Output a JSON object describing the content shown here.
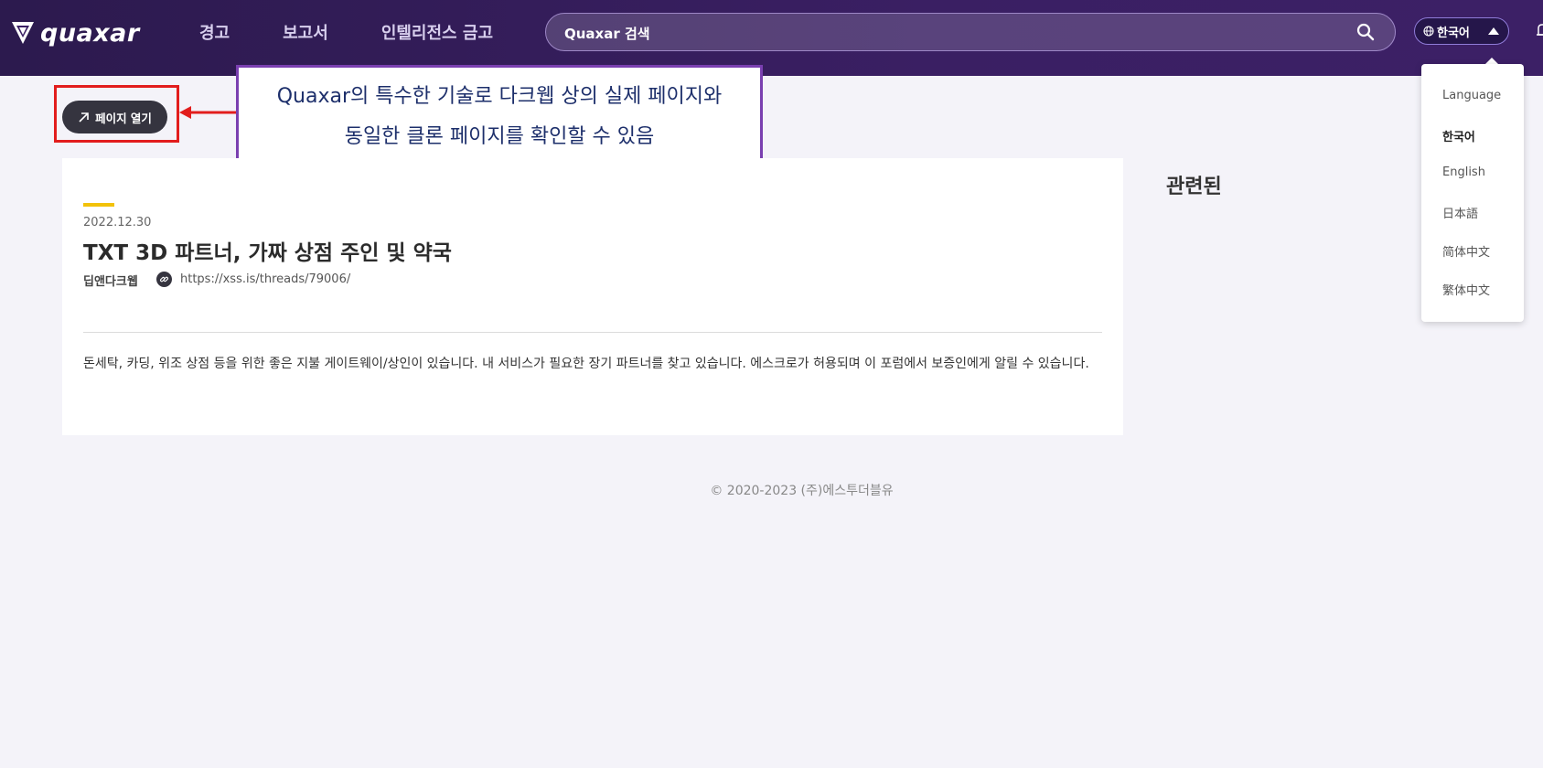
{
  "header": {
    "logo_text": "quaxar",
    "nav": [
      {
        "label": "경고"
      },
      {
        "label": "보고서"
      },
      {
        "label": "인텔리전스 금고"
      }
    ],
    "search": {
      "value": "Quaxar 검색"
    },
    "language_button": {
      "label": "한국어"
    }
  },
  "language_menu": {
    "items": [
      {
        "label": "Language"
      },
      {
        "label": "한국어",
        "active": true
      },
      {
        "label": "English"
      },
      {
        "label": "日本語"
      },
      {
        "label": "简体中文"
      },
      {
        "label": "繁体中文"
      }
    ]
  },
  "open_page_button": {
    "label": "페이지 열기"
  },
  "callout": {
    "line1": "Quaxar의 특수한 기술로 다크웹 상의 실제 페이지와",
    "line2": "동일한 클론 페이지를 확인할 수 있음"
  },
  "article": {
    "date": "2022.12.30",
    "title": "TXT 3D 파트너, 가짜 상점 주인 및 약국",
    "source": "딥앤다크웹",
    "url": "https://xss.is/threads/79006/",
    "body": "돈세탁, 카딩, 위조 상점 등을 위한 좋은 지불 게이트웨이/상인이 있습니다. 내 서비스가 필요한 장기 파트너를 찾고 있습니다. 에스크로가 허용되며 이 포럼에서 보증인에게 알릴 수 있습니다."
  },
  "related": {
    "title": "관련된"
  },
  "footer": {
    "copyright": "© 2020-2023 (주)에스투더블유"
  },
  "colors": {
    "header_bg": "#2c1a4e",
    "accent_yellow": "#f2c20a",
    "highlight_red": "#e21d1d",
    "callout_border": "#7a3fb0",
    "callout_text": "#1d2f6b"
  }
}
